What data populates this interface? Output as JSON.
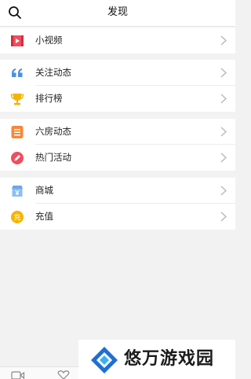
{
  "header": {
    "title": "发现",
    "search_icon": "search-icon"
  },
  "groups": [
    {
      "items": [
        {
          "label": "小视频",
          "icon": "video-play-icon",
          "color": "#f04e5e"
        }
      ]
    },
    {
      "items": [
        {
          "label": "关注动态",
          "icon": "quote-icon",
          "color": "#4a90e2"
        },
        {
          "label": "排行榜",
          "icon": "trophy-icon",
          "color": "#f5b400"
        }
      ]
    },
    {
      "items": [
        {
          "label": "六房动态",
          "icon": "list-icon",
          "color": "#f5883a"
        },
        {
          "label": "热门活动",
          "icon": "pencil-icon",
          "color": "#f04e5e"
        }
      ]
    },
    {
      "items": [
        {
          "label": "商城",
          "icon": "shop-icon",
          "color": "#6aa8e8"
        },
        {
          "label": "充值",
          "icon": "recharge-icon",
          "color": "#f5b400"
        }
      ]
    }
  ],
  "watermark": {
    "text": "悠万游戏园"
  },
  "colors": {
    "background": "#f2f2f2",
    "card": "#ffffff",
    "chevron": "#b8b8b8"
  }
}
